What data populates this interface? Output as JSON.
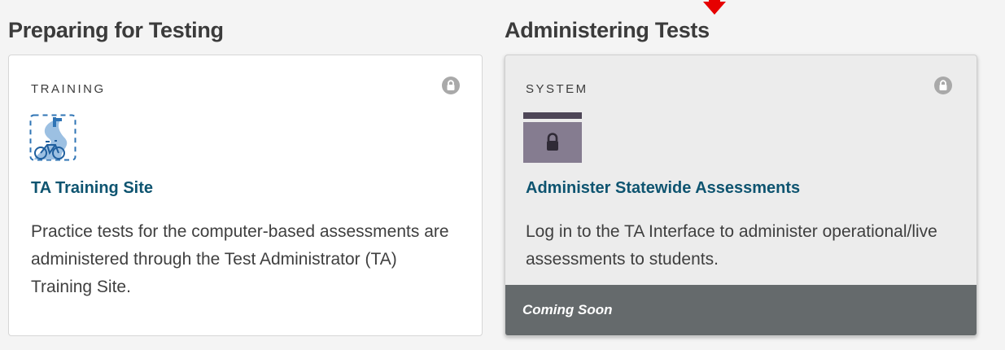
{
  "sections": {
    "preparing": {
      "title": "Preparing for Testing",
      "card": {
        "category": "TRAINING",
        "icon": "bicycle-path-icon",
        "link_label": "TA Training Site",
        "description": "Practice tests for the computer-based assessments are administered through the Test Administrator (TA) Training Site.",
        "locked_icon": "lock-icon"
      }
    },
    "administering": {
      "title": "Administering Tests",
      "card": {
        "category": "SYSTEM",
        "icon": "locked-window-icon",
        "link_label": "Administer Statewide Assessments",
        "description": "Log in to the TA Interface to administer operational/live assessments to students.",
        "locked_icon": "lock-icon",
        "status_label": "Coming Soon"
      }
    }
  },
  "colors": {
    "accent_link": "#0e5470",
    "status_bar": "#656a6c",
    "indicator_arrow": "#e60000"
  }
}
